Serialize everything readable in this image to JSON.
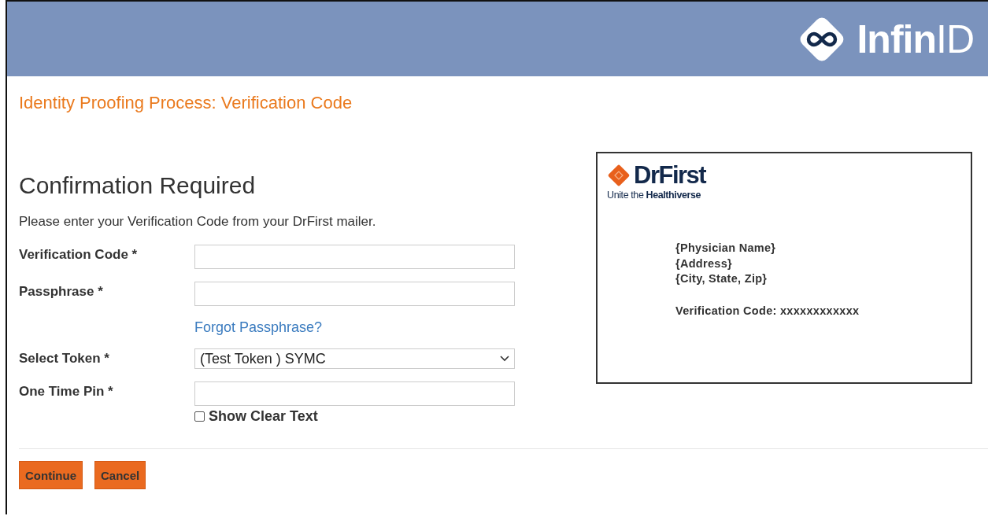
{
  "header": {
    "logo": "**Infin**ID"
  },
  "page_title": "Identity Proofing Process: Verification Code",
  "heading": "Confirmation Required",
  "instruction": "Please enter your Verification Code from your DrFirst mailer.",
  "form": [
    {
      "kind": "text",
      "label": "Verification Code *"
    },
    {
      "kind": "text",
      "label": "Passphrase *"
    },
    {
      "kind": "link",
      "text": "Forgot Passphrase?"
    },
    {
      "kind": "select",
      "label": "Select Token *",
      "value": "(Test Token ) SYMC"
    },
    {
      "kind": "text",
      "label": "One Time Pin *"
    },
    {
      "kind": "checkbox",
      "label": "Show Clear Text",
      "checked": false
    }
  ],
  "mailer": {
    "brand": "DrFirst",
    "tagline": "Unite the **Healthiverse**",
    "address_lines": [
      "{Physician Name}",
      "{Address}",
      "{City, State, Zip}"
    ],
    "code_line": "Verification Code: xxxxxxxxxxxx"
  },
  "buttons": [
    "Continue",
    "Cancel"
  ]
}
